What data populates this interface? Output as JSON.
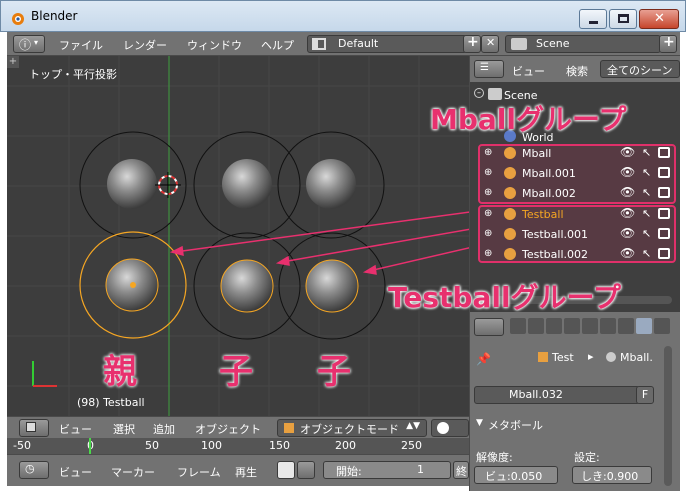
{
  "window": {
    "title": "Blender"
  },
  "info_header": {
    "menus": [
      "ファイル",
      "レンダー",
      "ウィンドウ",
      "ヘルプ"
    ],
    "layout": "Default",
    "scene": "Scene"
  },
  "viewport": {
    "view_label": "トップ・平行投影",
    "object_label": "(98) Testball",
    "labels": {
      "parent": "親",
      "child1": "子",
      "child2": "子"
    }
  },
  "viewport_header": {
    "menus": [
      "ビュー",
      "選択",
      "追加",
      "オブジェクト"
    ],
    "mode": "オブジェクトモード"
  },
  "ruler": {
    "ticks": [
      "-50",
      "0",
      "50",
      "100",
      "150",
      "200",
      "250"
    ]
  },
  "timeline_header": {
    "menus": [
      "ビュー",
      "マーカー",
      "フレーム",
      "再生"
    ],
    "start_label": "開始:",
    "start_value": "1",
    "end_label": "終"
  },
  "outliner_header": {
    "menus": [
      "ビュー",
      "検索"
    ],
    "filter": "全てのシーン"
  },
  "outliner": {
    "scene": "Scene",
    "world": "World",
    "items": [
      "Mball",
      "Mball.001",
      "Mball.002",
      "Testball",
      "Testball.001",
      "Testball.002"
    ]
  },
  "annotations": {
    "mball_group": "Mballグループ",
    "testball_group": "Testballグループ"
  },
  "properties": {
    "breadcrumb_object": "Test",
    "breadcrumb_data": "Mball.",
    "datablock": "Mball.032",
    "fake_user": "F",
    "panel_title": "メタボール",
    "resolution_label": "解像度:",
    "threshold_label": "設定:",
    "view_res": "ビュ:0.050",
    "render_res": "しき:0.900"
  },
  "colors": {
    "selected_outline": "#f5a623",
    "annotation": "#e8306e",
    "viewport_bg": "#3d3d3d"
  }
}
